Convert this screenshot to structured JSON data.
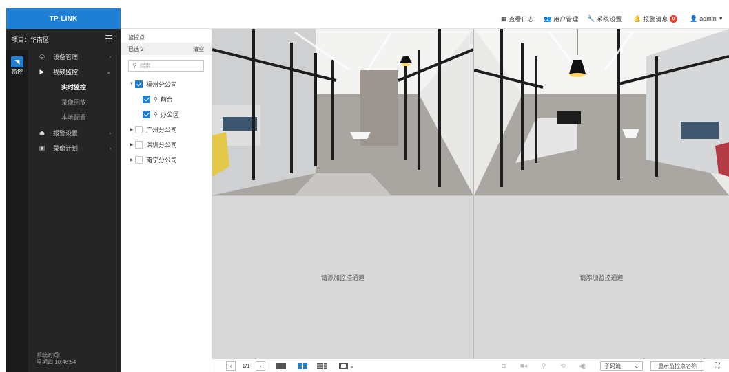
{
  "brand": {
    "logo_text": "TP-LINK",
    "accent": "#1f7fd4"
  },
  "header": {
    "log_label": "查看日志",
    "users_label": "用户管理",
    "settings_label": "系统设置",
    "alarm_label": "报警消息",
    "alarm_count": "0",
    "user_label": "admin"
  },
  "nav": {
    "project": "项目：华南区",
    "rail_label": "监控",
    "menu": {
      "device": "设备管理",
      "video": "视频监控",
      "alarm": "报警设置",
      "record": "录像计划"
    },
    "video_sub": [
      "实时监控",
      "录像回放",
      "本地配置"
    ],
    "systime_label": "系统时间:",
    "systime_value": "星期四 10:46:54"
  },
  "tree": {
    "title": "监控点",
    "selected": "已选 2",
    "clear": "清空",
    "search_placeholder": "搜索",
    "nodes": {
      "fuzhou": "福州分公司",
      "qiantai": "前台",
      "office": "办公区",
      "guangzhou": "广州分公司",
      "shenzhen": "深圳分公司",
      "nanning": "南宁分公司"
    }
  },
  "grid": {
    "empty_text": "请添加监控通道"
  },
  "toolbar": {
    "page": "1/1",
    "stream_select": "子码流",
    "show_names_btn": "显示监控点名称"
  }
}
